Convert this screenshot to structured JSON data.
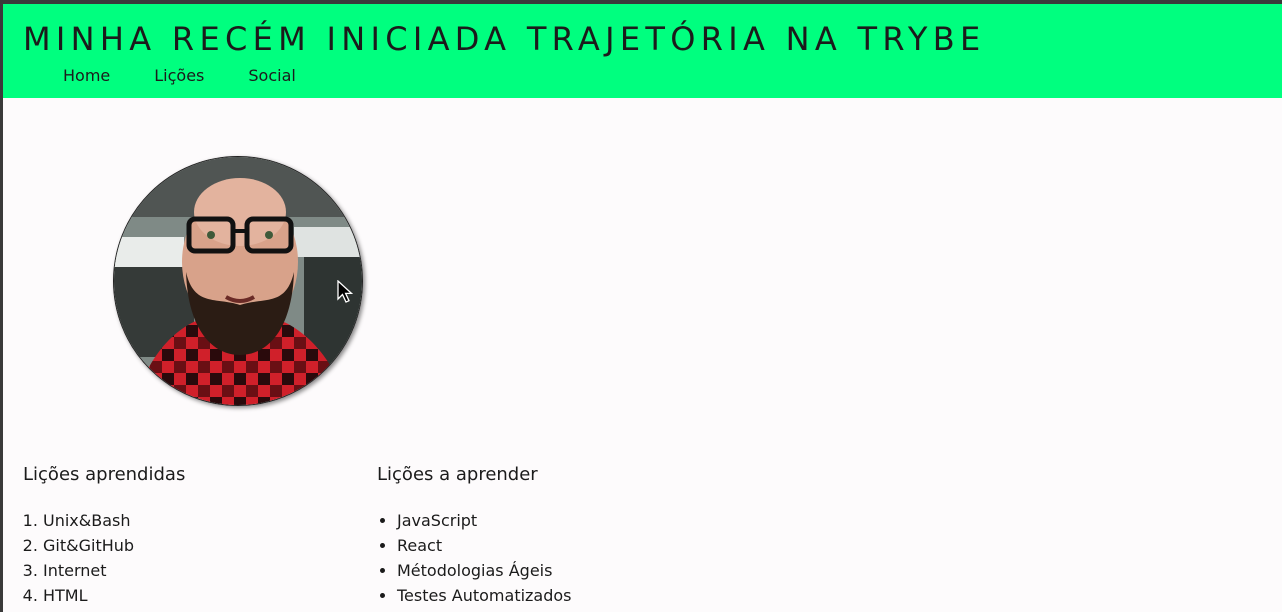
{
  "header": {
    "title": "MINHA RECÉM INICIADA TRAJETÓRIA NA TRYBE",
    "nav": [
      "Home",
      "Lições",
      "Social"
    ]
  },
  "learned": {
    "heading": "Lições aprendidas",
    "items": [
      "Unix&Bash",
      "Git&GitHub",
      "Internet",
      "HTML"
    ]
  },
  "to_learn": {
    "heading": "Lições a aprender",
    "items": [
      "JavaScript",
      "React",
      "Métodologias Ágeis",
      "Testes Automatizados"
    ]
  },
  "colors": {
    "header_bg": "#00ff7f",
    "page_bg": "#fdfbfc",
    "text": "#1b1b1b"
  },
  "icons": [
    "profile-photo",
    "mouse-cursor-icon"
  ]
}
